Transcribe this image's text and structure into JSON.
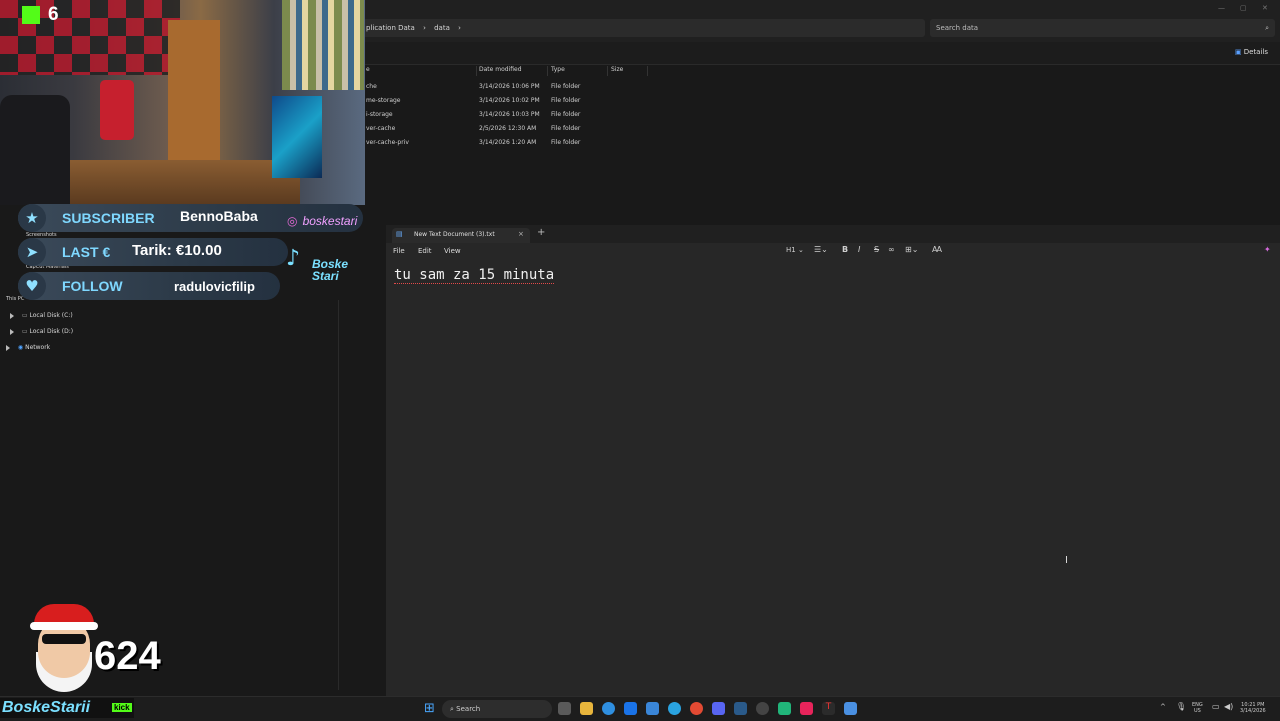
{
  "explorer": {
    "breadcrumb": [
      "plication Data",
      "data"
    ],
    "search_placeholder": "Search data",
    "details_label": "Details",
    "columns": [
      "e",
      "Date modified",
      "Type",
      "Size"
    ],
    "rows": [
      {
        "name": "che",
        "modified": "3/14/2026 10:06 PM",
        "type": "File folder"
      },
      {
        "name": "me-storage",
        "modified": "3/14/2026 10:02 PM",
        "type": "File folder"
      },
      {
        "name": "i-storage",
        "modified": "3/14/2026 10:03 PM",
        "type": "File folder"
      },
      {
        "name": "ver-cache",
        "modified": "2/5/2026 12:30 AM",
        "type": "File folder"
      },
      {
        "name": "ver-cache-priv",
        "modified": "3/14/2026 1:20 AM",
        "type": "File folder"
      }
    ],
    "nav": {
      "screenshots": "Screenshots",
      "capcut": "CapCut Materials",
      "thispc": "This PC",
      "disk_c": "Local Disk (C:)",
      "disk_d": "Local Disk (D:)",
      "network": "Network"
    }
  },
  "stream": {
    "viewer_count": "6",
    "alerts": {
      "subscriber_label": "SUBSCRIBER",
      "subscriber_name": "BennoBaba",
      "last_label": "LAST €",
      "last_value": "Tarik: €10.00",
      "follow_label": "FOLLOW",
      "follow_name": "radulovicfilip"
    },
    "instagram": "boskestari",
    "tiktok_line1": "Boske",
    "tiktok_line2": "Stari",
    "goal_count": "624",
    "brand": "BoskeStarii",
    "kick_tag": "kick"
  },
  "notepad": {
    "tab_title": "New Text Document (3).txt",
    "menu": [
      "File",
      "Edit",
      "View"
    ],
    "heading_tool": "H1",
    "content": "tu sam za 15 minuta"
  },
  "taskbar": {
    "search_label": "Search",
    "lang_line1": "ENG",
    "lang_line2": "US",
    "time": "10:21 PM",
    "date": "3/14/2026"
  },
  "colors": {
    "accent_kick": "#53fc18",
    "alert_title": "#7fd8ff",
    "spell_error": "#e24a4a"
  }
}
